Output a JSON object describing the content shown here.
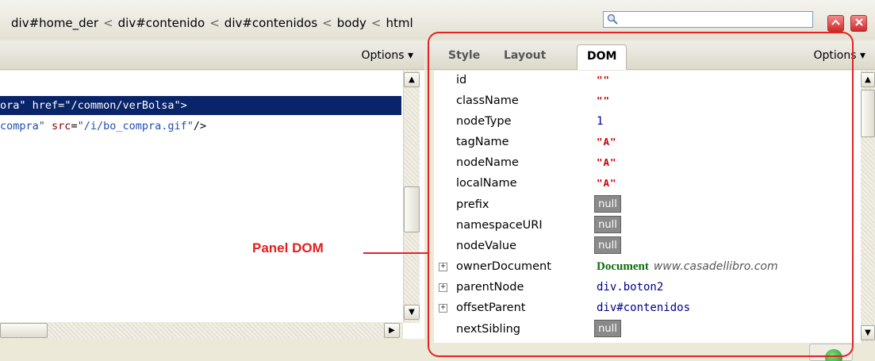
{
  "breadcrumb": {
    "items": [
      "div#home_der",
      "div#contenido",
      "div#contenidos",
      "body",
      "html"
    ],
    "separator": "<"
  },
  "search": {
    "placeholder": ""
  },
  "left_panel": {
    "options_label": "Options ▾",
    "code_lines": [
      {
        "prefix": "ora\"",
        "attr": "href",
        "value": "\"/common/verBolsa\"",
        "suffix": ">"
      },
      {
        "prefix": "compra\"",
        "attr": "src",
        "value": "\"/i/bo_compra.gif\"",
        "suffix": "/>"
      }
    ]
  },
  "right_panel": {
    "tabs": [
      {
        "label": "Style",
        "active": false
      },
      {
        "label": "Layout",
        "active": false
      },
      {
        "label": "DOM",
        "active": true
      }
    ],
    "options_label": "Options ▾",
    "dom_properties": [
      {
        "name": "id",
        "value": "\"\"",
        "kind": "string",
        "expandable": false
      },
      {
        "name": "className",
        "value": "\"\"",
        "kind": "string",
        "expandable": false
      },
      {
        "name": "nodeType",
        "value": "1",
        "kind": "number",
        "expandable": false
      },
      {
        "name": "tagName",
        "value": "\"A\"",
        "kind": "string",
        "expandable": false
      },
      {
        "name": "nodeName",
        "value": "\"A\"",
        "kind": "string",
        "expandable": false
      },
      {
        "name": "localName",
        "value": "\"A\"",
        "kind": "string",
        "expandable": false
      },
      {
        "name": "prefix",
        "value": "null",
        "kind": "null",
        "expandable": false
      },
      {
        "name": "namespaceURI",
        "value": "null",
        "kind": "null",
        "expandable": false
      },
      {
        "name": "nodeValue",
        "value": "null",
        "kind": "null",
        "expandable": false
      },
      {
        "name": "ownerDocument",
        "value": "Document",
        "extra": "www.casadellibro.com",
        "kind": "document",
        "expandable": true
      },
      {
        "name": "parentNode",
        "value": "div.boton2",
        "kind": "object",
        "expandable": true
      },
      {
        "name": "offsetParent",
        "value": "div#contenidos",
        "kind": "object",
        "expandable": true
      },
      {
        "name": "nextSibling",
        "value": "null",
        "kind": "null",
        "expandable": false
      }
    ]
  },
  "annotation": {
    "label": "Panel DOM",
    "color": "#e52222"
  },
  "icons": {
    "search": "magnifier-icon",
    "minimize": "collapse-up-icon",
    "close": "close-icon",
    "scroll_up": "arrow-up-icon",
    "scroll_down": "arrow-down-icon",
    "scroll_right": "arrow-right-icon",
    "expand": "plus-icon",
    "status": "status-ok-icon"
  }
}
